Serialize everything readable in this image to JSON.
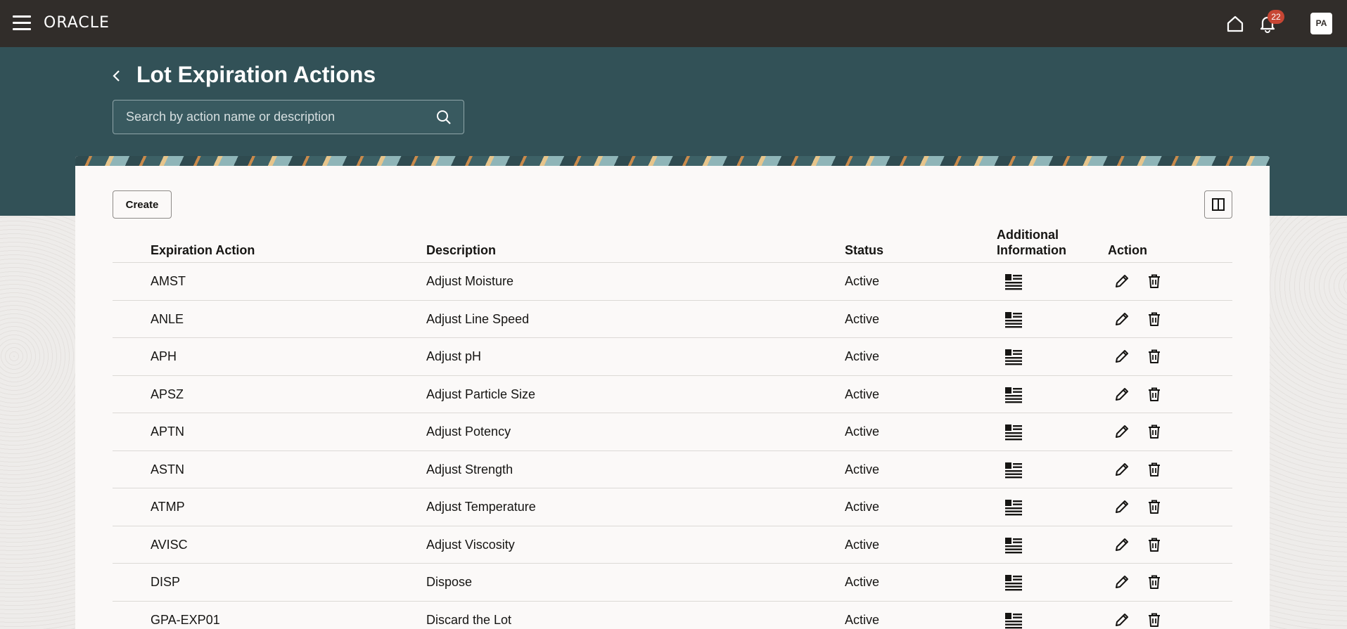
{
  "topbar": {
    "brand": "ORACLE",
    "notification_count": "22",
    "avatar_initials": "PA",
    "icons": [
      "menu-icon",
      "home-icon",
      "bell-icon"
    ]
  },
  "header": {
    "title": "Lot Expiration Actions",
    "search_placeholder": "Search by action name or description"
  },
  "toolbar": {
    "create_label": "Create"
  },
  "table": {
    "columns": {
      "code": "Expiration Action",
      "description": "Description",
      "status": "Status",
      "info_line1": "Additional",
      "info_line2": "Information",
      "action": "Action"
    },
    "rows": [
      {
        "code": "AMST",
        "description": "Adjust Moisture",
        "status": "Active"
      },
      {
        "code": "ANLE",
        "description": "Adjust Line Speed",
        "status": "Active"
      },
      {
        "code": "APH",
        "description": "Adjust pH",
        "status": "Active"
      },
      {
        "code": "APSZ",
        "description": "Adjust Particle Size",
        "status": "Active"
      },
      {
        "code": "APTN",
        "description": "Adjust Potency",
        "status": "Active"
      },
      {
        "code": "ASTN",
        "description": "Adjust Strength",
        "status": "Active"
      },
      {
        "code": "ATMP",
        "description": "Adjust Temperature",
        "status": "Active"
      },
      {
        "code": "AVISC",
        "description": "Adjust Viscosity",
        "status": "Active"
      },
      {
        "code": "DISP",
        "description": "Dispose",
        "status": "Active"
      },
      {
        "code": "GPA-EXP01",
        "description": "Discard the Lot",
        "status": "Active"
      }
    ]
  },
  "colors": {
    "topbar": "#312d2a",
    "header_band": "#325157",
    "badge": "#c74634",
    "card": "#fbf9f8"
  }
}
